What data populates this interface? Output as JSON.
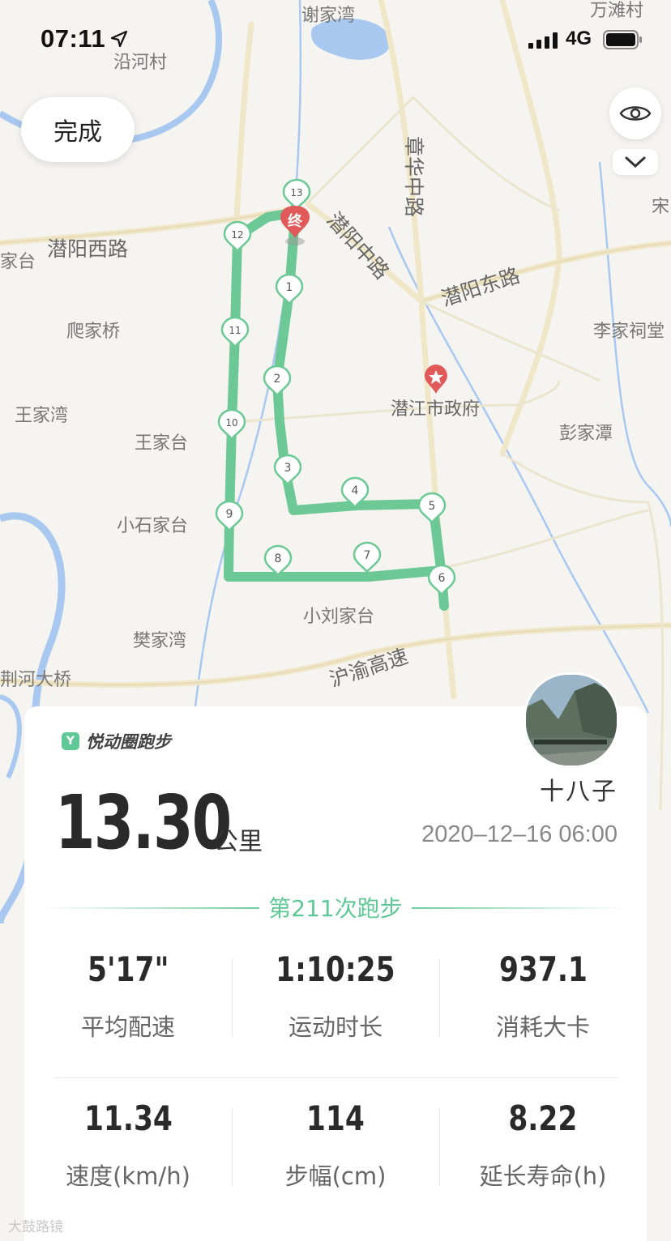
{
  "status_bar": {
    "time": "07:11",
    "network": "4G"
  },
  "map": {
    "done_label": "完成",
    "finish_marker": "终",
    "place_labels": [
      "谢家湾",
      "万滩村",
      "沿河村",
      "章华中路",
      "潜阳西路",
      "潜阳中路",
      "潜阳东路",
      "爬家桥",
      "李家祠堂",
      "王家湾",
      "王家台",
      "潜江市政府",
      "彭家潭",
      "小石家台",
      "小刘家台",
      "樊家湾",
      "沪渝高速",
      "荆河大桥",
      "宋",
      "家台"
    ],
    "waypoints": [
      "1",
      "2",
      "3",
      "4",
      "5",
      "6",
      "7",
      "8",
      "9",
      "10",
      "11",
      "12",
      "13"
    ],
    "route_color": "#5fc896",
    "marker_color": "#e05a5a"
  },
  "card": {
    "brand": "悦动圈跑步",
    "brand_logo": "Y",
    "username": "十八子",
    "distance": "13.30",
    "distance_unit": "公里",
    "datetime": "2020–12–16 06:00",
    "run_count": "第211次跑步",
    "stats": [
      {
        "value": "5'17\"",
        "label": "平均配速"
      },
      {
        "value": "1:10:25",
        "label": "运动时长"
      },
      {
        "value": "937.1",
        "label": "消耗大卡"
      },
      {
        "value": "11.34",
        "label": "速度(km/h)"
      },
      {
        "value": "114",
        "label": "步幅(cm)"
      },
      {
        "value": "8.22",
        "label": "延长寿命(h)"
      }
    ]
  },
  "watermark": "大鼓路镜"
}
